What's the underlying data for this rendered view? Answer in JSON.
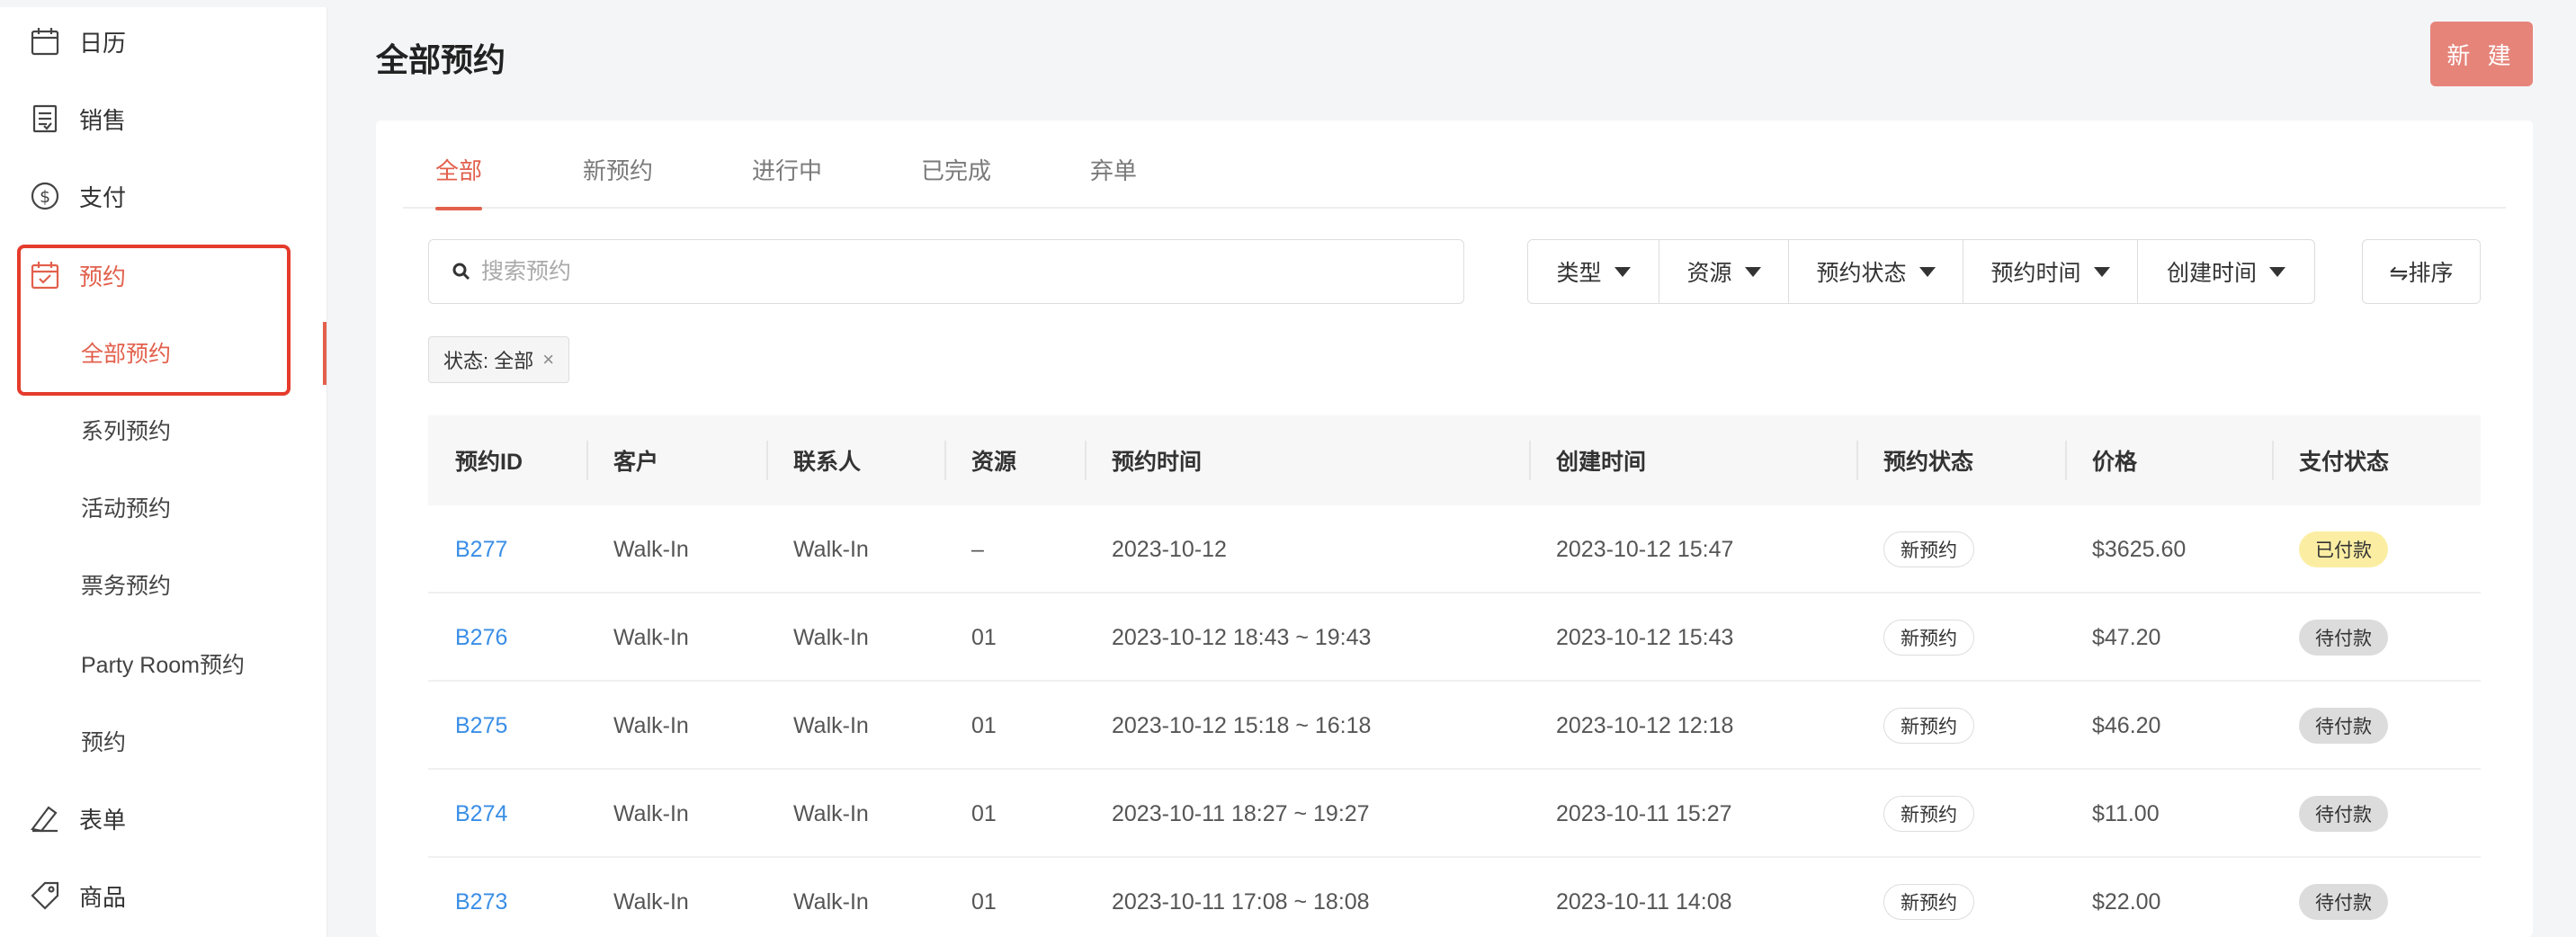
{
  "sidebar": {
    "items": [
      {
        "label": "日历",
        "icon": "calendar-icon"
      },
      {
        "label": "销售",
        "icon": "receipt-icon"
      },
      {
        "label": "支付",
        "icon": "dollar-icon"
      },
      {
        "label": "预约",
        "icon": "calendar-check-icon"
      },
      {
        "label": "表单",
        "icon": "pen-icon"
      },
      {
        "label": "商品",
        "icon": "tag-icon"
      }
    ],
    "sub_items": [
      {
        "label": "全部预约"
      },
      {
        "label": "系列预约"
      },
      {
        "label": "活动预约"
      },
      {
        "label": "票务预约"
      },
      {
        "label": "Party Room预约"
      },
      {
        "label": "预约"
      }
    ]
  },
  "header": {
    "title": "全部预约",
    "new_button": "新 建"
  },
  "tabs": [
    {
      "label": "全部"
    },
    {
      "label": "新预约"
    },
    {
      "label": "进行中"
    },
    {
      "label": "已完成"
    },
    {
      "label": "弃单"
    }
  ],
  "search": {
    "placeholder": "搜索预约"
  },
  "filters": [
    {
      "label": "类型"
    },
    {
      "label": "资源"
    },
    {
      "label": "预约状态"
    },
    {
      "label": "预约时间"
    },
    {
      "label": "创建时间"
    }
  ],
  "sort_button": "⇋排序",
  "chip": {
    "label": "状态: 全部",
    "close": "×"
  },
  "table": {
    "headers": [
      "预约ID",
      "客户",
      "联系人",
      "资源",
      "预约时间",
      "创建时间",
      "预约状态",
      "价格",
      "支付状态"
    ],
    "rows": [
      {
        "id": "B277",
        "customer": "Walk-In",
        "contact": "Walk-In",
        "resource": "–",
        "time": "2023-10-12",
        "created": "2023-10-12 15:47",
        "status": "新预约",
        "price": "$3625.60",
        "pay": "已付款",
        "pay_type": "paid"
      },
      {
        "id": "B276",
        "customer": "Walk-In",
        "contact": "Walk-In",
        "resource": "01",
        "time": "2023-10-12 18:43 ~ 19:43",
        "created": "2023-10-12 15:43",
        "status": "新预约",
        "price": "$47.20",
        "pay": "待付款",
        "pay_type": "unpaid"
      },
      {
        "id": "B275",
        "customer": "Walk-In",
        "contact": "Walk-In",
        "resource": "01",
        "time": "2023-10-12 15:18 ~ 16:18",
        "created": "2023-10-12 12:18",
        "status": "新预约",
        "price": "$46.20",
        "pay": "待付款",
        "pay_type": "unpaid"
      },
      {
        "id": "B274",
        "customer": "Walk-In",
        "contact": "Walk-In",
        "resource": "01",
        "time": "2023-10-11 18:27 ~ 19:27",
        "created": "2023-10-11 15:27",
        "status": "新预约",
        "price": "$11.00",
        "pay": "待付款",
        "pay_type": "unpaid"
      },
      {
        "id": "B273",
        "customer": "Walk-In",
        "contact": "Walk-In",
        "resource": "01",
        "time": "2023-10-11 17:08 ~ 18:08",
        "created": "2023-10-11 14:08",
        "status": "新预约",
        "price": "$22.00",
        "pay": "待付款",
        "pay_type": "unpaid"
      }
    ]
  },
  "colors": {
    "accent": "#e2604c",
    "link": "#3a8ee6",
    "highlight_box": "#e53b2c",
    "paid_badge": "#fbeea3",
    "unpaid_badge": "#dcdcdc"
  }
}
